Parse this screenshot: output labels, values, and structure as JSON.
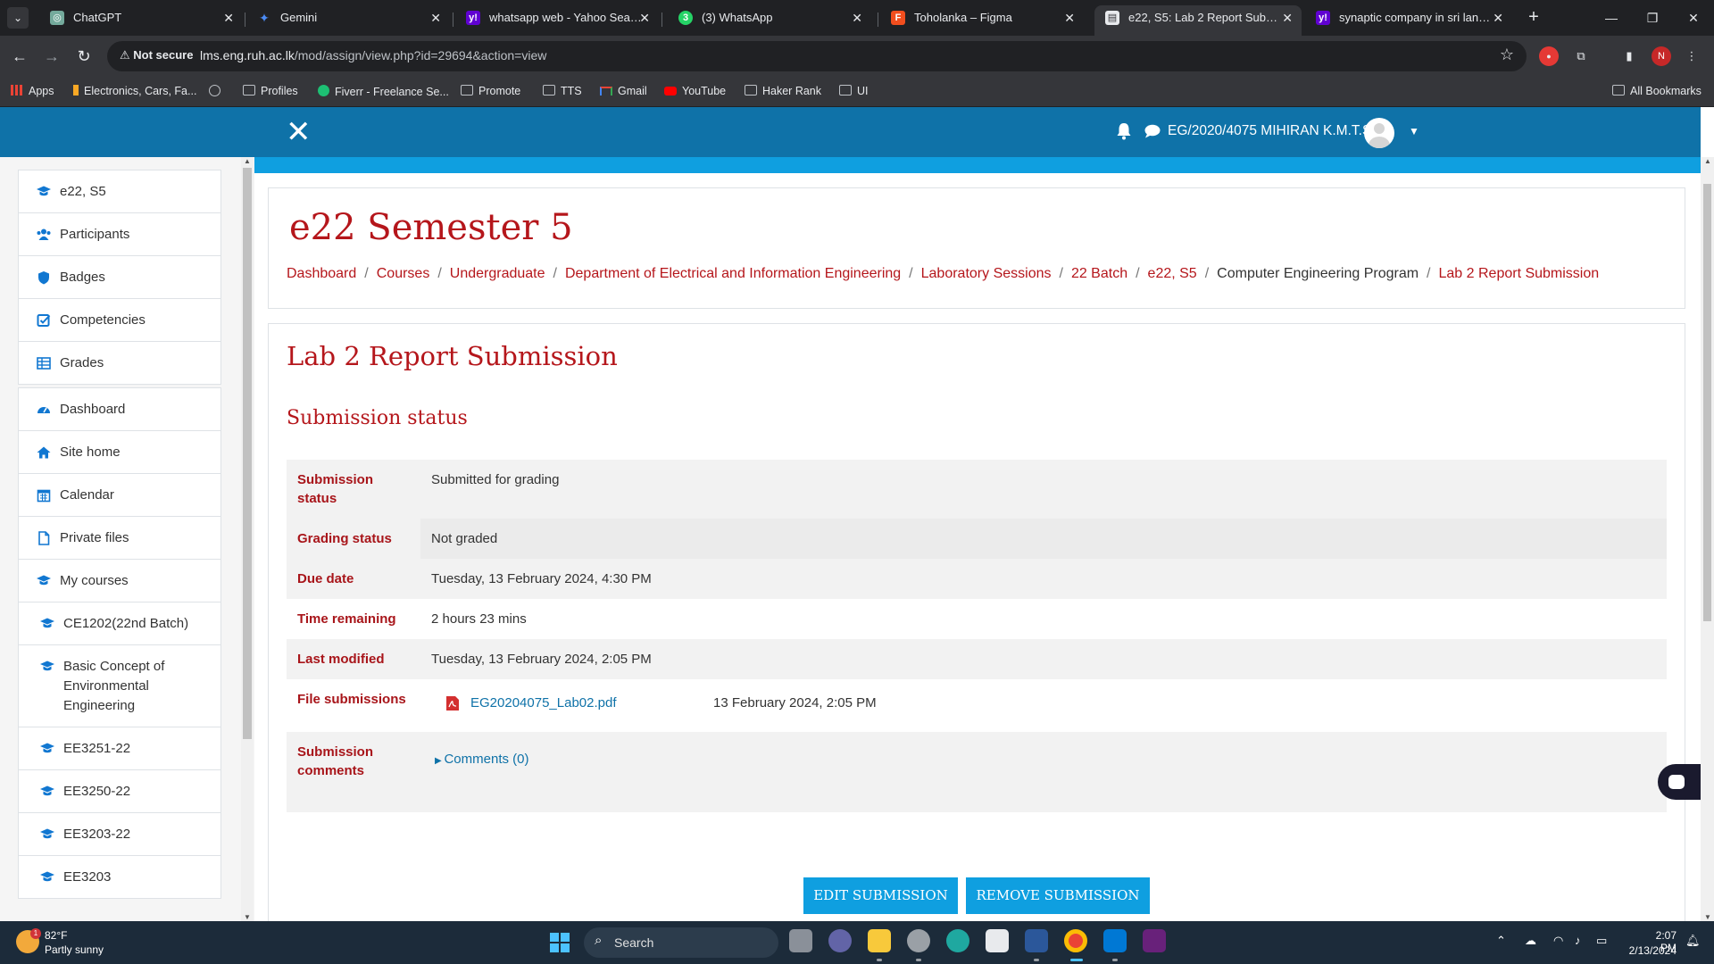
{
  "browser": {
    "tabs": [
      {
        "title": "ChatGPT",
        "icon": "chatgpt-icon",
        "color": "#74aa9c"
      },
      {
        "title": "Gemini",
        "icon": "gemini-icon",
        "color": "#4b8bf5"
      },
      {
        "title": "whatsapp web - Yahoo Search R",
        "icon": "yahoo-icon",
        "color": "#6001d2"
      },
      {
        "title": "(3) WhatsApp",
        "icon": "whatsapp-icon",
        "color": "#25d366"
      },
      {
        "title": "Toholanka – Figma",
        "icon": "figma-icon",
        "color": "#f24e1e"
      },
      {
        "title": "e22, S5: Lab 2 Report Submissio",
        "icon": "moodle-icon",
        "color": "#e8eaed",
        "active": true
      },
      {
        "title": "synaptic company in sri lanka -",
        "icon": "yahoo-icon",
        "color": "#6001d2"
      }
    ],
    "security_label": "Not secure",
    "url_host": "lms.eng.ruh.ac.lk",
    "url_path": "/mod/assign/view.php?id=29694&action=view",
    "profile_initial": "N",
    "bookmarks": [
      {
        "label": "Apps",
        "icon": "apps-grid-icon"
      },
      {
        "label": "Electronics, Cars, Fa...",
        "icon": "shop-icon"
      },
      {
        "label": "",
        "icon": "globe-icon"
      },
      {
        "label": "Profiles",
        "icon": "folder-icon"
      },
      {
        "label": "Fiverr - Freelance Se...",
        "icon": "fiverr-icon"
      },
      {
        "label": "Promote",
        "icon": "folder-icon"
      },
      {
        "label": "TTS",
        "icon": "folder-icon"
      },
      {
        "label": "Gmail",
        "icon": "gmail-icon"
      },
      {
        "label": "YouTube",
        "icon": "youtube-icon"
      },
      {
        "label": "Haker Rank",
        "icon": "folder-icon"
      },
      {
        "label": "UI",
        "icon": "folder-icon"
      }
    ],
    "all_bookmarks": "All Bookmarks"
  },
  "site": {
    "user_name": "EG/2020/4075 MIHIRAN K.M.T.S.",
    "accent": "#0f72a8",
    "title_color": "#b5161b"
  },
  "sidebar": {
    "course_items": [
      {
        "label": "e22, S5",
        "icon": "graduation-cap-icon"
      },
      {
        "label": "Participants",
        "icon": "users-icon"
      },
      {
        "label": "Badges",
        "icon": "shield-icon"
      },
      {
        "label": "Competencies",
        "icon": "check-square-icon"
      },
      {
        "label": "Grades",
        "icon": "table-icon"
      }
    ],
    "site_items": [
      {
        "label": "Dashboard",
        "icon": "dashboard-icon"
      },
      {
        "label": "Site home",
        "icon": "home-icon"
      },
      {
        "label": "Calendar",
        "icon": "calendar-icon"
      },
      {
        "label": "Private files",
        "icon": "file-icon"
      },
      {
        "label": "My courses",
        "icon": "graduation-cap-icon"
      }
    ],
    "courses": [
      {
        "label": "CE1202(22nd Batch)"
      },
      {
        "label": "Basic Concept of Environmental Engineering"
      },
      {
        "label": "EE3251-22"
      },
      {
        "label": "EE3250-22"
      },
      {
        "label": "EE3203-22"
      },
      {
        "label": "EE3203"
      }
    ]
  },
  "page": {
    "course_title": "e22 Semester 5",
    "breadcrumb": [
      {
        "label": "Dashboard",
        "link": true
      },
      {
        "label": "Courses",
        "link": true
      },
      {
        "label": "Undergraduate",
        "link": true
      },
      {
        "label": "Department of Electrical and Information Engineering",
        "link": true
      },
      {
        "label": "Laboratory Sessions",
        "link": true
      },
      {
        "label": "22 Batch",
        "link": true
      },
      {
        "label": "e22, S5",
        "link": true
      },
      {
        "label": "Computer Engineering Program",
        "link": false
      },
      {
        "label": "Lab 2 Report Submission",
        "link": true
      }
    ],
    "breadcrumb_separator": "/",
    "title": "Lab 2 Report Submission",
    "status_heading": "Submission status",
    "status": {
      "submission_status_label": "Submission status",
      "submission_status_value": "Submitted for grading",
      "grading_status_label": "Grading status",
      "grading_status_value": "Not graded",
      "due_date_label": "Due date",
      "due_date_value": "Tuesday, 13 February 2024, 4:30 PM",
      "time_remaining_label": "Time remaining",
      "time_remaining_value": "2 hours 23 mins",
      "last_modified_label": "Last modified",
      "last_modified_value": "Tuesday, 13 February 2024, 2:05 PM",
      "file_submissions_label": "File submissions",
      "file_name": "EG20204075_Lab02.pdf",
      "file_date": "13 February 2024, 2:05 PM",
      "comments_label": "Submission comments",
      "comments_link": "Comments (0)"
    },
    "edit_button": "EDIT SUBMISSION",
    "remove_button": "REMOVE SUBMISSION"
  },
  "taskbar": {
    "weather_temp": "82°F",
    "weather_desc": "Partly sunny",
    "weather_badge": "1",
    "search_label": "Search",
    "time": "2:07 PM",
    "date": "2/13/2024"
  }
}
